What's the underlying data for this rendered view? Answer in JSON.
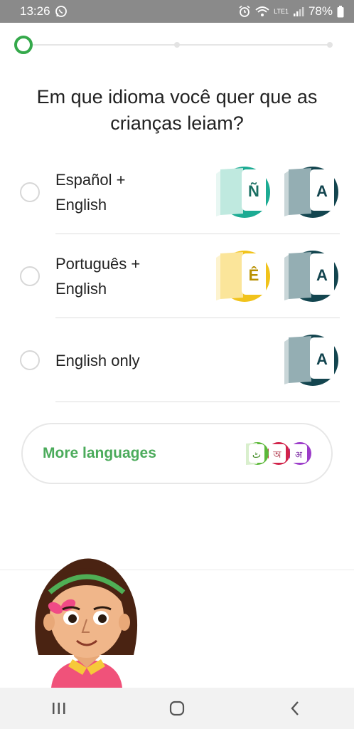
{
  "status_bar": {
    "time": "13:26",
    "battery": "78%",
    "network_label": "LTE1",
    "icons": [
      "whatsapp-icon",
      "alarm-icon",
      "wifi-icon",
      "signal-icon",
      "battery-icon"
    ]
  },
  "progress": {
    "current_step": 1,
    "total_steps": 3
  },
  "question": "Em que idioma você quer que as crianças leiam?",
  "options": [
    {
      "label": "Español + English",
      "books": [
        {
          "letter": "Ñ",
          "color": "#1cab93"
        },
        {
          "letter": "A",
          "color": "#13454f"
        }
      ]
    },
    {
      "label": "Português + English",
      "books": [
        {
          "letter": "Ê",
          "color": "#f1c31b"
        },
        {
          "letter": "A",
          "color": "#13454f"
        }
      ]
    },
    {
      "label": "English only",
      "books": [
        {
          "letter": "A",
          "color": "#13454f"
        }
      ]
    }
  ],
  "more_languages": {
    "label": "More languages",
    "mini_books": [
      {
        "letter": "ٹ",
        "color": "#5cb83a"
      },
      {
        "letter": "অ",
        "color": "#d1234a"
      },
      {
        "letter": "अ",
        "color": "#9c3cc9"
      }
    ]
  },
  "nav_bar": {
    "buttons": [
      "recent-apps-icon",
      "home-icon",
      "back-icon"
    ]
  },
  "colors": {
    "accent_green": "#35a94b",
    "more_languages_text": "#4bab5b",
    "status_bar_bg": "#8a8a8a"
  }
}
